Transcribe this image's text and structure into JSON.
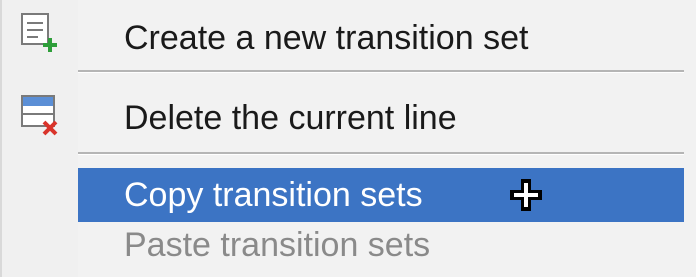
{
  "menu": {
    "items": [
      {
        "label": "Create a new transition set",
        "icon": "add-transition-icon",
        "enabled": true
      },
      {
        "label": "Delete the current line",
        "icon": "delete-line-icon",
        "enabled": true
      },
      {
        "label": "Copy transition sets",
        "icon": "",
        "enabled": true,
        "highlighted": true
      },
      {
        "label": "Paste transition sets",
        "icon": "",
        "enabled": false
      }
    ]
  },
  "colors": {
    "highlight": "#3c74c4",
    "add_badge": "#2e9e3a",
    "delete_badge": "#d9342b",
    "icon_header": "#5b8fd6"
  },
  "cursor": {
    "icon": "crosshair-cursor-icon"
  }
}
